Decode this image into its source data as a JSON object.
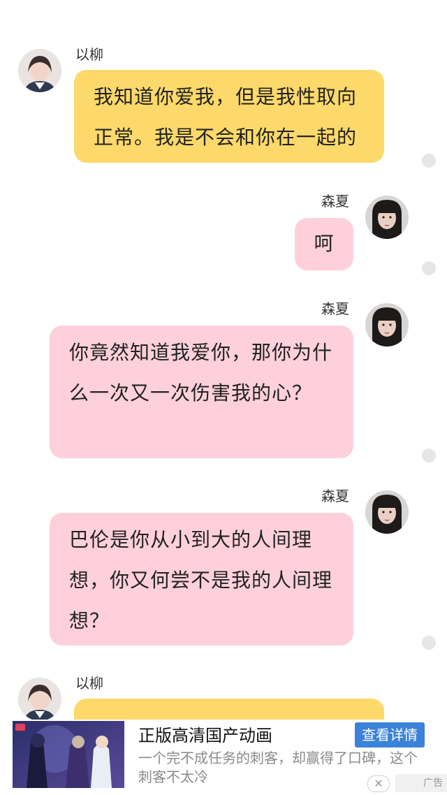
{
  "messages": [
    {
      "sender": "以柳",
      "text": "我知道你爱我，但是我性取向正常。我是不会和你在一起的",
      "side": "left",
      "color": "#fcd96a"
    },
    {
      "sender": "森夏",
      "text": "呵",
      "side": "right",
      "color": "#fdd0dc"
    },
    {
      "sender": "森夏",
      "text": "你竟然知道我爱你，那你为什么一次又一次伤害我的心？",
      "side": "right",
      "color": "#fdd0dc"
    },
    {
      "sender": "森夏",
      "text": "巴伦是你从小到大的人间理想，你又何尝不是我的人间理想？",
      "side": "right",
      "color": "#fdd0dc"
    },
    {
      "sender": "以柳",
      "text": "",
      "side": "left",
      "color": "#fcd96a"
    }
  ],
  "ad": {
    "title": "正版高清国产动画",
    "button": "查看详情",
    "description": "一个完不成任务的刺客，却赢得了口碑，这个刺客不太冷",
    "close_icon": "✕",
    "label": "广告",
    "accent": "#3b82d8"
  },
  "icons": {
    "avatar_left": "avatar-yiliu",
    "avatar_right": "avatar-senxia",
    "status_dot": "status-dot"
  }
}
